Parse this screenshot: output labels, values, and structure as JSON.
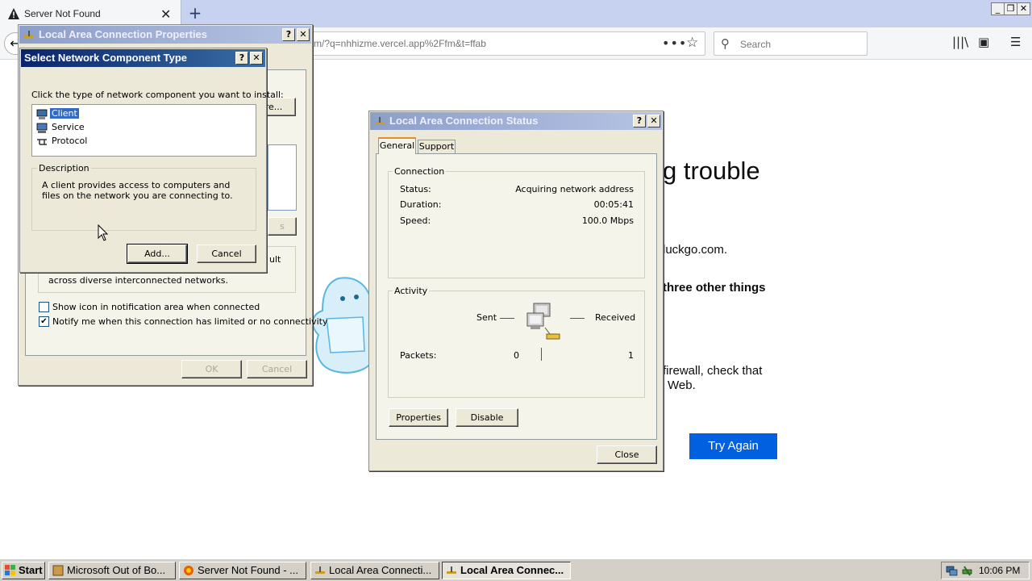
{
  "browser": {
    "tab_title": "Server Not Found",
    "url": "m/?q=nhhizme.vercel.app%2Ffm&t=ffab",
    "search_placeholder": "Search",
    "window_controls": [
      "_",
      "❐",
      "✕"
    ]
  },
  "error_page": {
    "heading_fragment": "g trouble",
    "line1_fragment": "luckgo.com.",
    "line2_fragment": "three other things",
    "line3_fragment": "firewall, check that",
    "line4_fragment": "Web.",
    "try_again_label": "Try Again"
  },
  "properties_dialog": {
    "title": "Local Area Connection Properties",
    "btn_configure_fragment": "re...",
    "desc_fragment_line1": "ult",
    "desc_fragment_line2": "across diverse interconnected networks.",
    "show_icon_label": "Show icon in notification area when connected",
    "show_icon_checked": false,
    "notify_label": "Notify me when this connection has limited or no connectivity",
    "notify_checked": true,
    "ok_label": "OK",
    "cancel_label": "Cancel",
    "props_fragment": "s"
  },
  "select_dialog": {
    "title": "Select Network Component Type",
    "instruction": "Click the type of network component you want to install:",
    "items": [
      "Client",
      "Service",
      "Protocol"
    ],
    "selected_index": 0,
    "description_label": "Description",
    "description_text": "A client provides access to computers and files on the network you are connecting to.",
    "add_label": "Add...",
    "cancel_label": "Cancel"
  },
  "status_dialog": {
    "title": "Local Area Connection Status",
    "tabs": [
      "General",
      "Support"
    ],
    "connection_label": "Connection",
    "status_label": "Status:",
    "status_value": "Acquiring network address",
    "duration_label": "Duration:",
    "duration_value": "00:05:41",
    "speed_label": "Speed:",
    "speed_value": "100.0 Mbps",
    "activity_label": "Activity",
    "sent_label": "Sent",
    "received_label": "Received",
    "packets_label": "Packets:",
    "packets_sent": "0",
    "packets_received": "1",
    "properties_label": "Properties",
    "disable_label": "Disable",
    "close_label": "Close"
  },
  "taskbar": {
    "start_label": "Start",
    "tasks": [
      "Microsoft Out of Bo...",
      "Server Not Found - ...",
      "Local Area Connecti...",
      "Local Area Connec..."
    ],
    "clock": "10:06 PM"
  }
}
